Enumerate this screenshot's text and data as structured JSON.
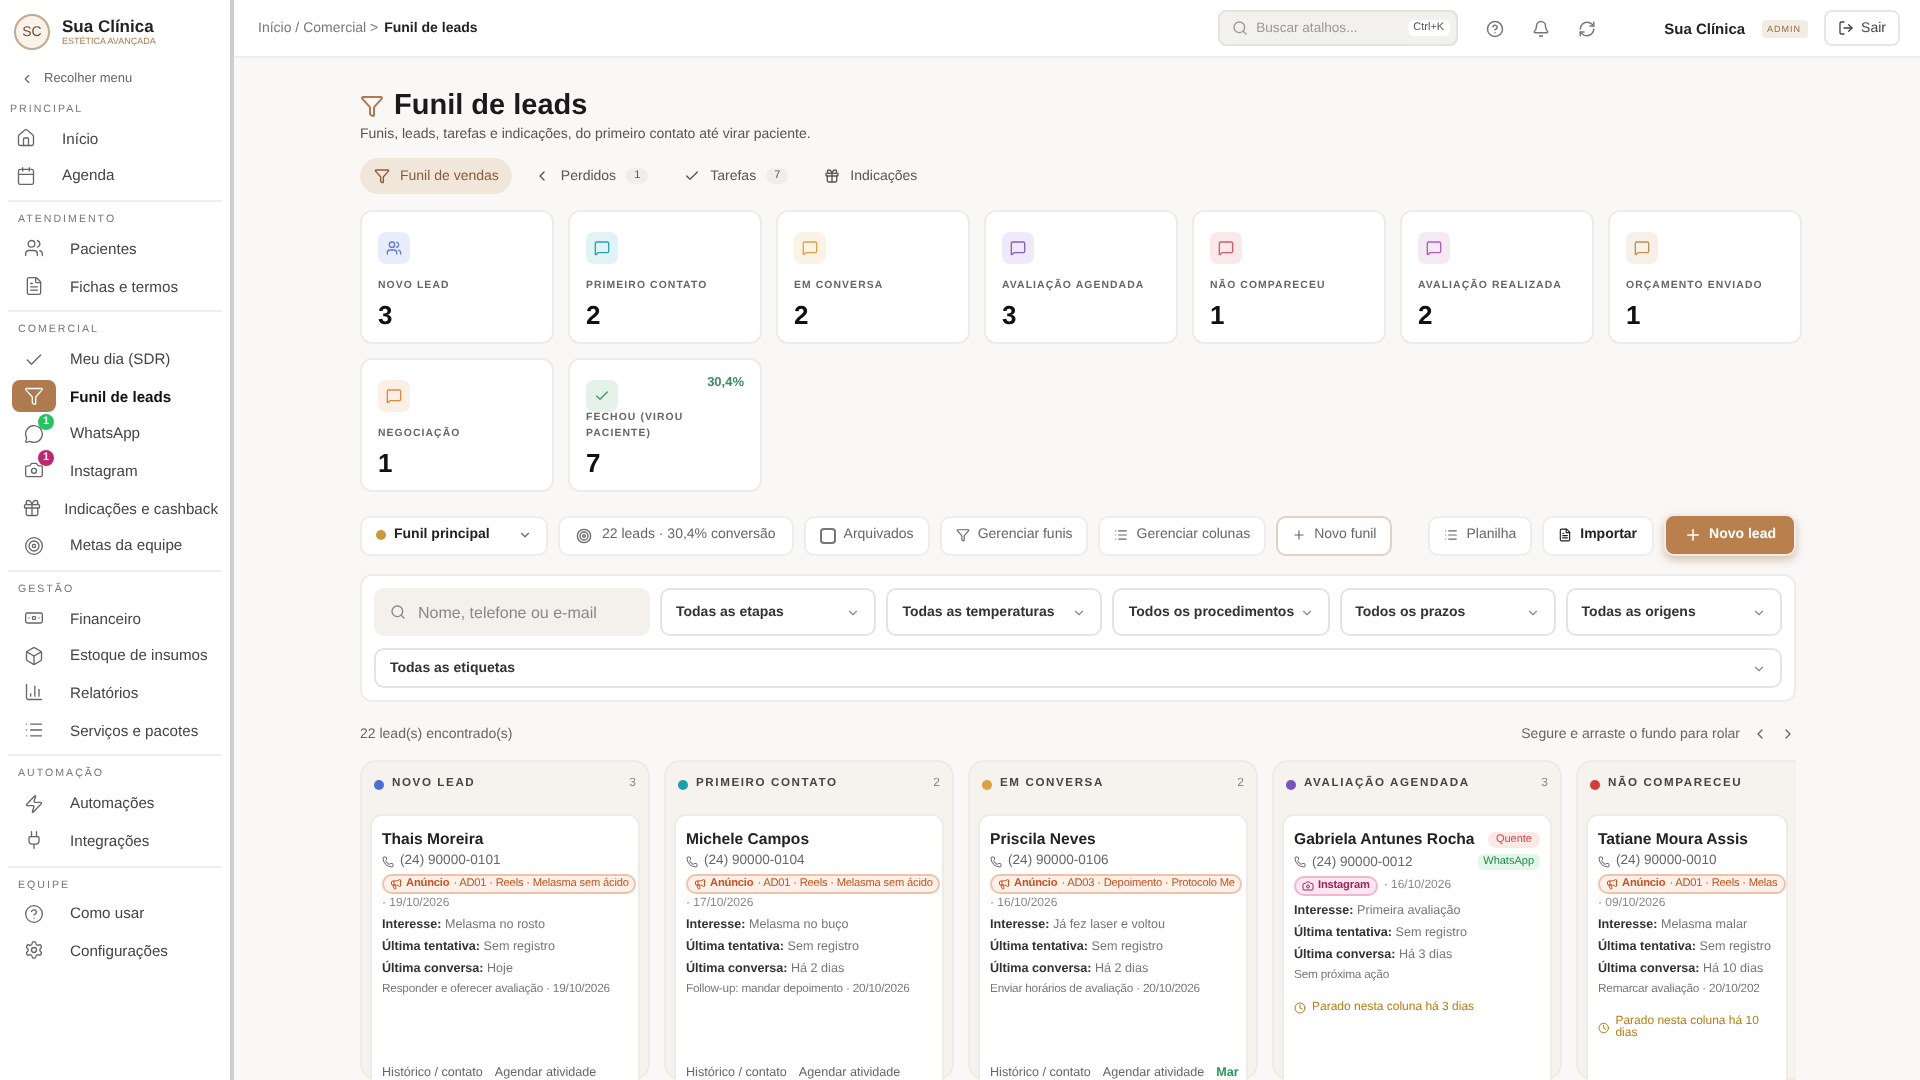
{
  "brand": {
    "initials": "SC",
    "name": "Sua Clínica",
    "tagline": "ESTÉTICA AVANÇADA"
  },
  "collapse": "Recolher menu",
  "sidebar": [
    {
      "title": "PRINCIPAL",
      "items": [
        {
          "label": "Início",
          "selected": false
        },
        {
          "label": "Agenda",
          "selected": false
        }
      ]
    },
    {
      "title": "ATENDIMENTO",
      "items": [
        {
          "label": "Pacientes",
          "selected": false
        },
        {
          "label": "Fichas e termos",
          "selected": false
        }
      ]
    },
    {
      "title": "COMERCIAL",
      "items": [
        {
          "label": "Meu dia (SDR)",
          "selected": false
        },
        {
          "label": "Funil de leads",
          "selected": true
        },
        {
          "label": "WhatsApp",
          "selected": false,
          "badge": {
            "text": "1",
            "color": "#22c55e"
          }
        },
        {
          "label": "Instagram",
          "selected": false,
          "badge": {
            "text": "1",
            "color": "#c0266d"
          }
        },
        {
          "label": "Indicações e cashback",
          "selected": false
        },
        {
          "label": "Metas da equipe",
          "selected": false
        }
      ]
    },
    {
      "title": "GESTÃO",
      "items": [
        {
          "label": "Financeiro",
          "selected": false
        },
        {
          "label": "Estoque de insumos",
          "selected": false
        },
        {
          "label": "Relatórios",
          "selected": false
        },
        {
          "label": "Serviços e pacotes",
          "selected": false
        }
      ]
    },
    {
      "title": "AUTOMAÇÃO",
      "items": [
        {
          "label": "Automações",
          "selected": false
        },
        {
          "label": "Integrações",
          "selected": false
        }
      ]
    },
    {
      "title": "EQUIPE",
      "items": [
        {
          "label": "Como usar",
          "selected": false
        },
        {
          "label": "Configurações",
          "selected": false
        }
      ]
    }
  ],
  "breadcrumb": {
    "trail": "Início / Comercial >",
    "current": "Funil de leads"
  },
  "search": {
    "placeholder": "Buscar atalhos...",
    "shortcut": "Ctrl+K"
  },
  "user": {
    "name": "Sua Clínica",
    "role": "ADMIN"
  },
  "logout": "Sair",
  "page": {
    "title": "Funil de leads",
    "subtitle": "Funis, leads, tarefas e indicações, do primeiro contato até virar paciente."
  },
  "tabs": [
    {
      "label": "Funil de vendas",
      "selected": true
    },
    {
      "label": "Perdidos",
      "count": "1",
      "selected": false
    },
    {
      "label": "Tarefas",
      "count": "7",
      "selected": false
    },
    {
      "label": "Indicações",
      "selected": false
    }
  ],
  "stages": [
    {
      "label": "NOVO LEAD",
      "value": "3",
      "color": "#5b7bd6"
    },
    {
      "label": "PRIMEIRO CONTATO",
      "value": "2",
      "color": "#22a3b5"
    },
    {
      "label": "EM CONVERSA",
      "value": "2",
      "color": "#e0a23f"
    },
    {
      "label": "AVALIAÇÃO AGENDADA",
      "value": "3",
      "color": "#8a5bd6"
    },
    {
      "label": "NÃO COMPARECEU",
      "value": "1",
      "color": "#d65b6b"
    },
    {
      "label": "AVALIAÇÃO REALIZADA",
      "value": "2",
      "color": "#b65bb0"
    },
    {
      "label": "ORÇAMENTO ENVIADO",
      "value": "1",
      "color": "#c0904f"
    },
    {
      "label": "NEGOCIAÇÃO",
      "value": "1",
      "color": "#e08a40"
    },
    {
      "label": "FECHOU (VIROU PACIENTE)",
      "value": "7",
      "color": "#3f9a5e",
      "rate": "30,4%"
    }
  ],
  "toolbar": {
    "funnel": {
      "label": "Funil principal",
      "color": "#c99a3b"
    },
    "stats": "22 leads · 30,4% conversão",
    "archived": {
      "label": "Arquivados",
      "checked": false
    },
    "actions": [
      {
        "label": "Gerenciar funis",
        "kind": "plain"
      },
      {
        "label": "Gerenciar colunas",
        "kind": "plain"
      },
      {
        "label": "Novo funil",
        "kind": "outline"
      }
    ],
    "right": [
      {
        "label": "Planilha",
        "kind": "plain"
      },
      {
        "label": "Importar",
        "kind": "strong"
      },
      {
        "label": "Novo lead",
        "kind": "primary"
      }
    ]
  },
  "filters": {
    "search_placeholder": "Nome, telefone ou e-mail",
    "selects": [
      "Todas as etapas",
      "Todas as temperaturas",
      "Todos os procedimentos",
      "Todos os prazos",
      "Todas as origens"
    ],
    "tags": "Todas as etiquetas"
  },
  "results": "22 lead(s) encontrado(s)",
  "scroll_hint": "Segure e arraste o fundo para rolar",
  "columns": [
    {
      "title": "NOVO LEAD",
      "count": "3",
      "color": "#4a6fd6",
      "cards": [
        {
          "name": "Thais Moreira",
          "phone": "(24) 90000-0101",
          "source": {
            "kind": "ad",
            "label": "Anúncio",
            "detail": "· AD01 · Reels · Melasma sem ácido"
          },
          "date": "· 19/10/2026",
          "fields": [
            {
              "label": "Interesse:",
              "value": "Melasma no rosto"
            },
            {
              "label": "Última tentativa:",
              "value": "Sem registro"
            },
            {
              "label": "Última conversa:",
              "value": "Hoje"
            }
          ],
          "next": "Responder e oferecer avaliação · 19/10/2026",
          "actions": [
            {
              "label": "Histórico / contato",
              "kind": "link"
            },
            {
              "label": "Agendar atividade",
              "kind": "link"
            }
          ]
        }
      ]
    },
    {
      "title": "PRIMEIRO CONTATO",
      "count": "2",
      "color": "#1ca0a8",
      "cards": [
        {
          "name": "Michele Campos",
          "phone": "(24) 90000-0104",
          "source": {
            "kind": "ad",
            "label": "Anúncio",
            "detail": "· AD01 · Reels · Melasma sem ácido"
          },
          "date": "· 17/10/2026",
          "fields": [
            {
              "label": "Interesse:",
              "value": "Melasma no buço"
            },
            {
              "label": "Última tentativa:",
              "value": "Sem registro"
            },
            {
              "label": "Última conversa:",
              "value": "Há 2 dias"
            }
          ],
          "next": "Follow-up: mandar depoimento · 20/10/2026",
          "actions": [
            {
              "label": "Histórico / contato",
              "kind": "link"
            },
            {
              "label": "Agendar atividade",
              "kind": "link"
            }
          ]
        }
      ]
    },
    {
      "title": "EM CONVERSA",
      "count": "2",
      "color": "#e0a040",
      "cards": [
        {
          "name": "Priscila Neves",
          "phone": "(24) 90000-0106",
          "source": {
            "kind": "ad",
            "label": "Anúncio",
            "detail": "· AD03 · Depoimento · Protocolo Me"
          },
          "date": "· 16/10/2026",
          "fields": [
            {
              "label": "Interesse:",
              "value": "Já fez laser e voltou"
            },
            {
              "label": "Última tentativa:",
              "value": "Sem registro"
            },
            {
              "label": "Última conversa:",
              "value": "Há 2 dias"
            }
          ],
          "next": "Enviar horários de avaliação · 20/10/2026",
          "actions": [
            {
              "label": "Histórico / contato",
              "kind": "link"
            },
            {
              "label": "Agendar atividade",
              "kind": "link"
            },
            {
              "label": "Mar",
              "kind": "accent"
            }
          ]
        }
      ]
    },
    {
      "title": "AVALIAÇÃO AGENDADA",
      "count": "3",
      "color": "#7a4fc7",
      "cards": [
        {
          "name": "Gabriela Antunes Rocha",
          "temperature": "Quente",
          "phone": "(24) 90000-0012",
          "channel": "WhatsApp",
          "source": {
            "kind": "instagram",
            "label": "Instagram"
          },
          "date": "· 16/10/2026",
          "fields": [
            {
              "label": "Interesse:",
              "value": "Primeira avaliação"
            },
            {
              "label": "Última tentativa:",
              "value": "Sem registro"
            },
            {
              "label": "Última conversa:",
              "value": "Há 3 dias"
            }
          ],
          "next": "Sem próxima ação",
          "stalled": "Parado nesta coluna há 3 dias"
        }
      ]
    },
    {
      "title": "NÃO COMPARECEU",
      "color": "#d43c3c",
      "cards": [
        {
          "name": "Tatiane Moura Assis",
          "phone": "(24) 90000-0010",
          "source": {
            "kind": "ad",
            "label": "Anúncio",
            "detail": "· AD01 · Reels · Melas"
          },
          "date": "· 09/10/2026",
          "fields": [
            {
              "label": "Interesse:",
              "value": "Melasma malar"
            },
            {
              "label": "Última tentativa:",
              "value": "Sem registro"
            },
            {
              "label": "Última conversa:",
              "value": "Há 10 dias"
            }
          ],
          "next": "Remarcar avaliação · 20/10/202",
          "stalled": "Parado nesta coluna há 10 dias"
        }
      ]
    }
  ]
}
